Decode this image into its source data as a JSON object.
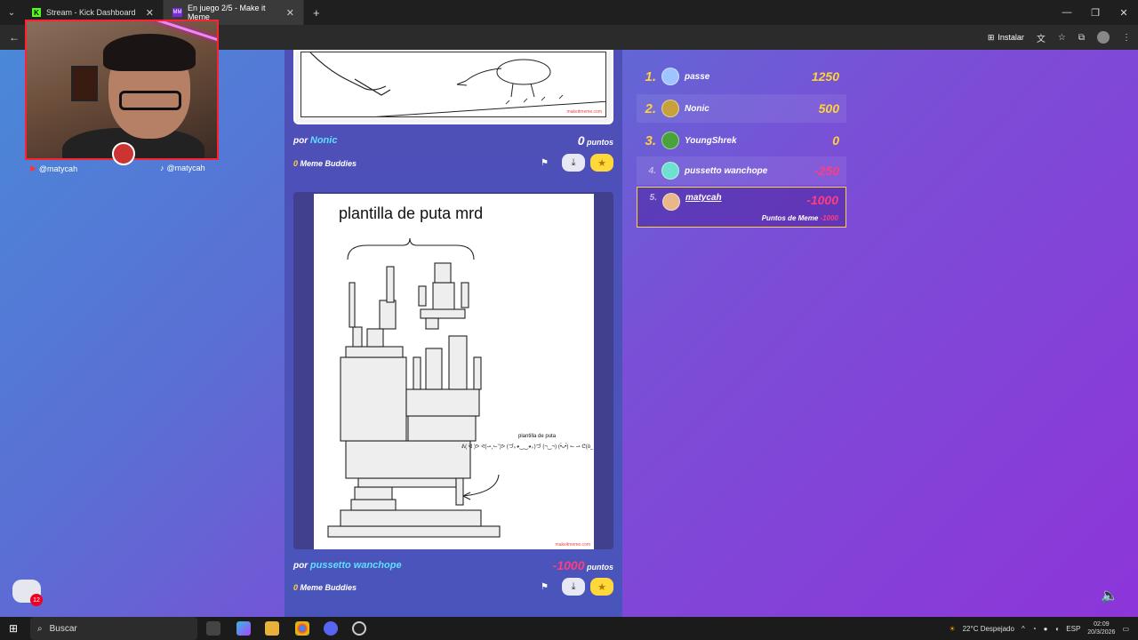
{
  "browser": {
    "tabs": [
      {
        "label": "Stream - Kick Dashboard",
        "icon": "kick-icon"
      },
      {
        "label": "En juego 2/5 - Make it Meme",
        "icon": "makeitmeme-icon"
      }
    ],
    "install_label": "Instalar"
  },
  "streamer": {
    "youtube_handle": "@matycah",
    "tiktok_handle": "@matycah"
  },
  "memes": [
    {
      "author_prefix": "por",
      "author": "Nonic",
      "points": "0",
      "points_label": "puntos",
      "buddies_count": "0",
      "buddies_label": "Meme Buddies",
      "watermark": "makeitmeme.com"
    },
    {
      "title": "plantilla de puta mrd",
      "caption_small": "plantilla de puta",
      "caption_line": "ᕕ( ᐛ )ᕗ ᕙ(⇀‸↼‶)ᕗ (づ｡◕‿‿◕｡)づ (¬‿¬) (•̀ᴗ•́) ↼ ⇀ ᕦ(ò_óˇ)ᕤ (◉_◉) (¬_¬\")",
      "author_prefix": "por",
      "author": "pussetto wanchope",
      "points": "-1000",
      "points_label": "puntos",
      "buddies_count": "0",
      "buddies_label": "Meme Buddies",
      "watermark": "makeitmeme.com"
    }
  ],
  "leaderboard": {
    "rows": [
      {
        "rank": "1.",
        "name": "passe",
        "score": "1250"
      },
      {
        "rank": "2.",
        "name": "Nonic",
        "score": "500"
      },
      {
        "rank": "3.",
        "name": "YoungShrek",
        "score": "0"
      },
      {
        "rank": "4.",
        "name": "pussetto wanchope",
        "score": "-250"
      },
      {
        "rank": "5.",
        "name": "matycah",
        "score": "-1000"
      }
    ],
    "me_sub_label": "Puntos de Meme",
    "me_sub_value": "-1000"
  },
  "chat_badge": "12",
  "taskbar": {
    "search_placeholder": "Buscar",
    "weather": "22°C Despejado",
    "lang": "ESP",
    "time": "02:09",
    "date": "20/3/2026"
  }
}
